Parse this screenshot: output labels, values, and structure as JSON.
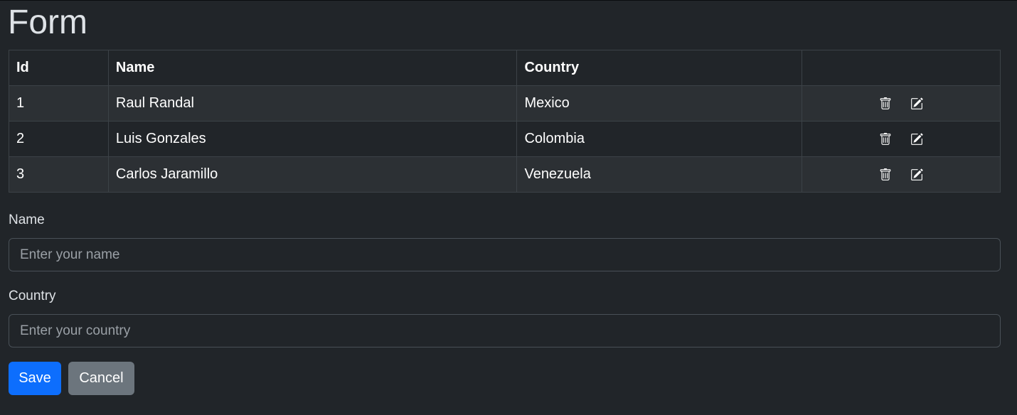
{
  "page": {
    "title": "Form"
  },
  "table": {
    "headers": [
      "Id",
      "Name",
      "Country",
      ""
    ],
    "rows": [
      {
        "id": "1",
        "name": "Raul Randal",
        "country": "Mexico"
      },
      {
        "id": "2",
        "name": "Luis Gonzales",
        "country": "Colombia"
      },
      {
        "id": "3",
        "name": "Carlos Jaramillo",
        "country": "Venezuela"
      }
    ],
    "row_actions": [
      "trash-icon",
      "edit-icon"
    ]
  },
  "form": {
    "name_label": "Name",
    "name_placeholder": "Enter your name",
    "name_value": "",
    "country_label": "Country",
    "country_placeholder": "Enter your country",
    "country_value": "",
    "save_label": "Save",
    "cancel_label": "Cancel"
  },
  "colors": {
    "background": "#212529",
    "primary": "#0d6efd",
    "secondary": "#6c757d",
    "striped_row": "#2c3034"
  }
}
